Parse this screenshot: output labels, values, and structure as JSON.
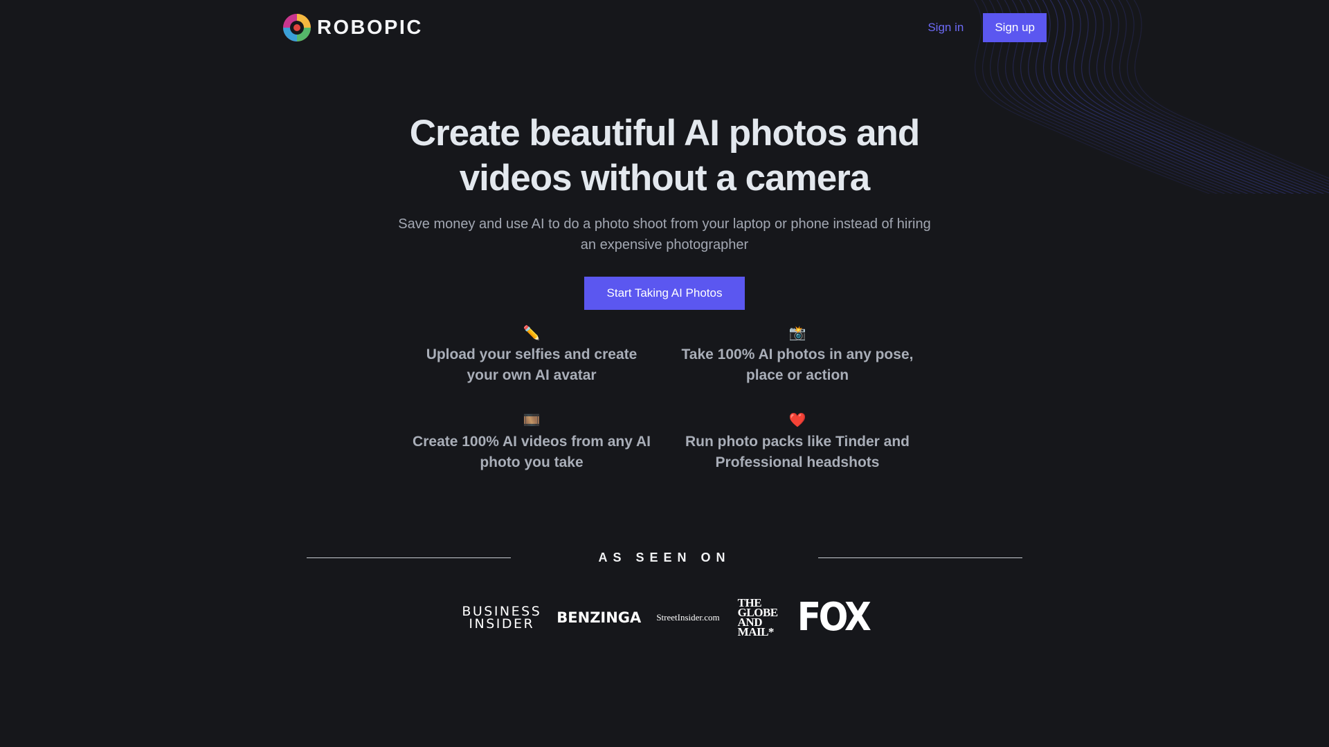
{
  "brand": {
    "name": "ROBOPIC",
    "logo_icon": "robopic-logo-icon"
  },
  "nav": {
    "signin_label": "Sign in",
    "signup_label": "Sign up"
  },
  "hero": {
    "title_line1": "Create beautiful AI photos and",
    "title_line2": "videos without a camera",
    "subtitle": "Save money and use AI to do a photo shoot from your laptop or phone instead of hiring an expensive photographer",
    "cta_label": "Start Taking AI Photos"
  },
  "features": [
    {
      "emoji": "✏️",
      "icon": "pencil-icon",
      "text": "Upload your selfies and create your own AI avatar"
    },
    {
      "emoji": "📸",
      "icon": "camera-flash-icon",
      "text": "Take 100% AI photos in any pose, place or action"
    },
    {
      "emoji": "🎞️",
      "icon": "film-frames-icon",
      "text": "Create 100% AI videos from any AI photo you take"
    },
    {
      "emoji": "❤️",
      "icon": "red-heart-icon",
      "text": "Run photo packs like Tinder and Professional headshots"
    }
  ],
  "as_seen_on": {
    "label": "AS SEEN ON",
    "logos": {
      "business_insider": {
        "line1": "BUSINESS",
        "line2": "INSIDER"
      },
      "benzinga": "BENZINGA",
      "streetinsider": "StreetInsider.com",
      "globe_and_mail": {
        "line1": "THE",
        "line2": "GLOBE",
        "line3": "AND",
        "line4": "MAIL*"
      },
      "fox": "FOX"
    }
  },
  "colors": {
    "background": "#16171b",
    "accent": "#5b57f0",
    "link": "#6d6af5",
    "heading": "#e3e8ee",
    "muted": "#a3a8b3"
  }
}
